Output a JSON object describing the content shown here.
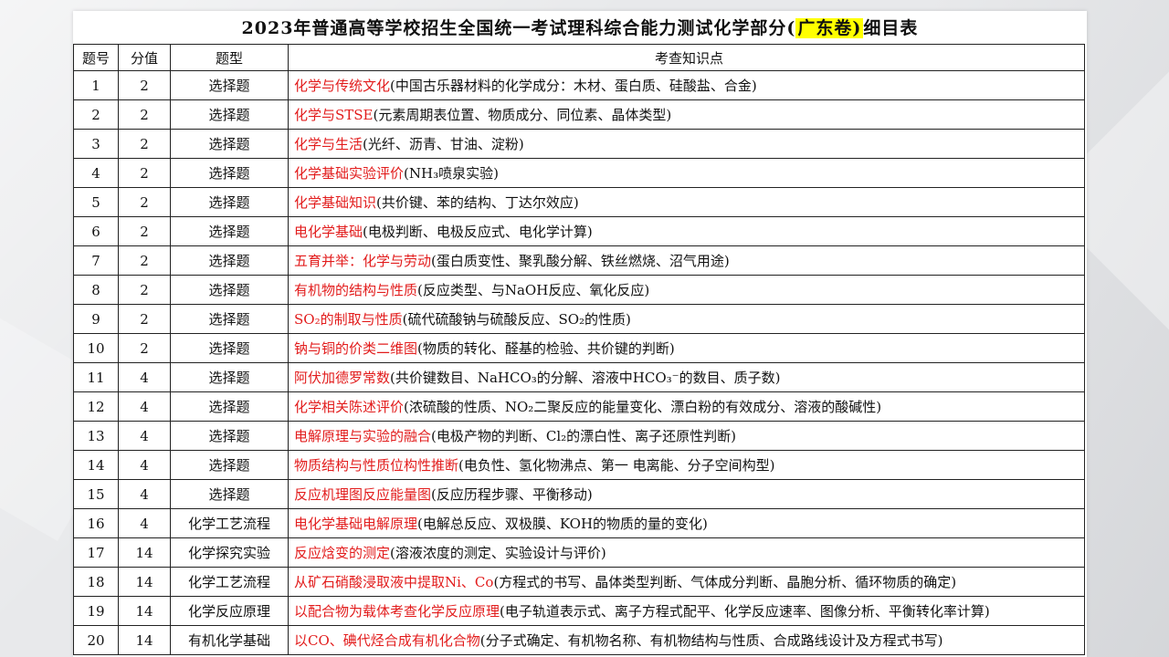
{
  "title": {
    "before": "2023年普通高等学校招生全国统一考试理科综合能力测试化学部分(",
    "highlight": "广东卷)",
    "after": "细目表"
  },
  "columns": [
    "题号",
    "分值",
    "题型",
    "考查知识点"
  ],
  "rows": [
    {
      "num": "1",
      "score": "2",
      "type": "选择题",
      "topic": "化学与传统文化",
      "detail": "(中国古乐器材料的化学成分：木材、蛋白质、硅酸盐、合金)"
    },
    {
      "num": "2",
      "score": "2",
      "type": "选择题",
      "topic": "化学与STSE",
      "detail": "(元素周期表位置、物质成分、同位素、晶体类型)"
    },
    {
      "num": "3",
      "score": "2",
      "type": "选择题",
      "topic": "化学与生活",
      "detail": "(光纤、沥青、甘油、淀粉)"
    },
    {
      "num": "4",
      "score": "2",
      "type": "选择题",
      "topic": "化学基础实验评价",
      "detail": "(NH₃喷泉实验)"
    },
    {
      "num": "5",
      "score": "2",
      "type": "选择题",
      "topic": "化学基础知识",
      "detail": "(共价键、苯的结构、丁达尔效应)"
    },
    {
      "num": "6",
      "score": "2",
      "type": "选择题",
      "topic": "电化学基础",
      "detail": "(电极判断、电极反应式、电化学计算)"
    },
    {
      "num": "7",
      "score": "2",
      "type": "选择题",
      "topic": "五育并举：化学与劳动",
      "detail": "(蛋白质变性、聚乳酸分解、铁丝燃烧、沼气用途)"
    },
    {
      "num": "8",
      "score": "2",
      "type": "选择题",
      "topic": "有机物的结构与性质",
      "detail": "(反应类型、与NaOH反应、氧化反应)"
    },
    {
      "num": "9",
      "score": "2",
      "type": "选择题",
      "topic": "SO₂的制取与性质",
      "detail": "(硫代硫酸钠与硫酸反应、SO₂的性质)"
    },
    {
      "num": "10",
      "score": "2",
      "type": "选择题",
      "topic": "钠与铜的价类二维图",
      "detail": "(物质的转化、醛基的检验、共价键的判断)"
    },
    {
      "num": "11",
      "score": "4",
      "type": "选择题",
      "topic": "阿伏加德罗常数",
      "detail": "(共价键数目、NaHCO₃的分解、溶液中HCO₃⁻的数目、质子数)"
    },
    {
      "num": "12",
      "score": "4",
      "type": "选择题",
      "topic": "化学相关陈述评价",
      "detail": "(浓硫酸的性质、NO₂二聚反应的能量变化、漂白粉的有效成分、溶液的酸碱性)"
    },
    {
      "num": "13",
      "score": "4",
      "type": "选择题",
      "topic": "电解原理与实验的融合",
      "detail": "(电极产物的判断、Cl₂的漂白性、离子还原性判断)"
    },
    {
      "num": "14",
      "score": "4",
      "type": "选择题",
      "topic": "物质结构与性质位构性推断",
      "detail": "(电负性、氢化物沸点、第一 电离能、分子空间构型)"
    },
    {
      "num": "15",
      "score": "4",
      "type": "选择题",
      "topic": "反应机理图反应能量图",
      "detail": "(反应历程步骤、平衡移动)"
    },
    {
      "num": "16",
      "score": "4",
      "type": "化学工艺流程",
      "topic": "电化学基础电解原理",
      "detail": "(电解总反应、双极膜、KOH的物质的量的变化)"
    },
    {
      "num": "17",
      "score": "14",
      "type": "化学探究实验",
      "topic": "反应焓变的测定",
      "detail": "(溶液浓度的测定、实验设计与评价)"
    },
    {
      "num": "18",
      "score": "14",
      "type": "化学工艺流程",
      "topic": "从矿石硝酸浸取液中提取Ni、Co",
      "detail": "(方程式的书写、晶体类型判断、气体成分判断、晶胞分析、循环物质的确定)"
    },
    {
      "num": "19",
      "score": "14",
      "type": "化学反应原理",
      "topic": "以配合物为载体考查化学反应原理",
      "detail": "(电子轨道表示式、离子方程式配平、化学反应速率、图像分析、平衡转化率计算)"
    },
    {
      "num": "20",
      "score": "14",
      "type": "有机化学基础",
      "topic": "以CO、碘代烃合成有机化合物",
      "detail": "(分子式确定、有机物名称、有机物结构与性质、合成路线设计及方程式书写)"
    }
  ],
  "colors": {
    "topic": "#e21c1c",
    "highlight": "#ffff00"
  }
}
